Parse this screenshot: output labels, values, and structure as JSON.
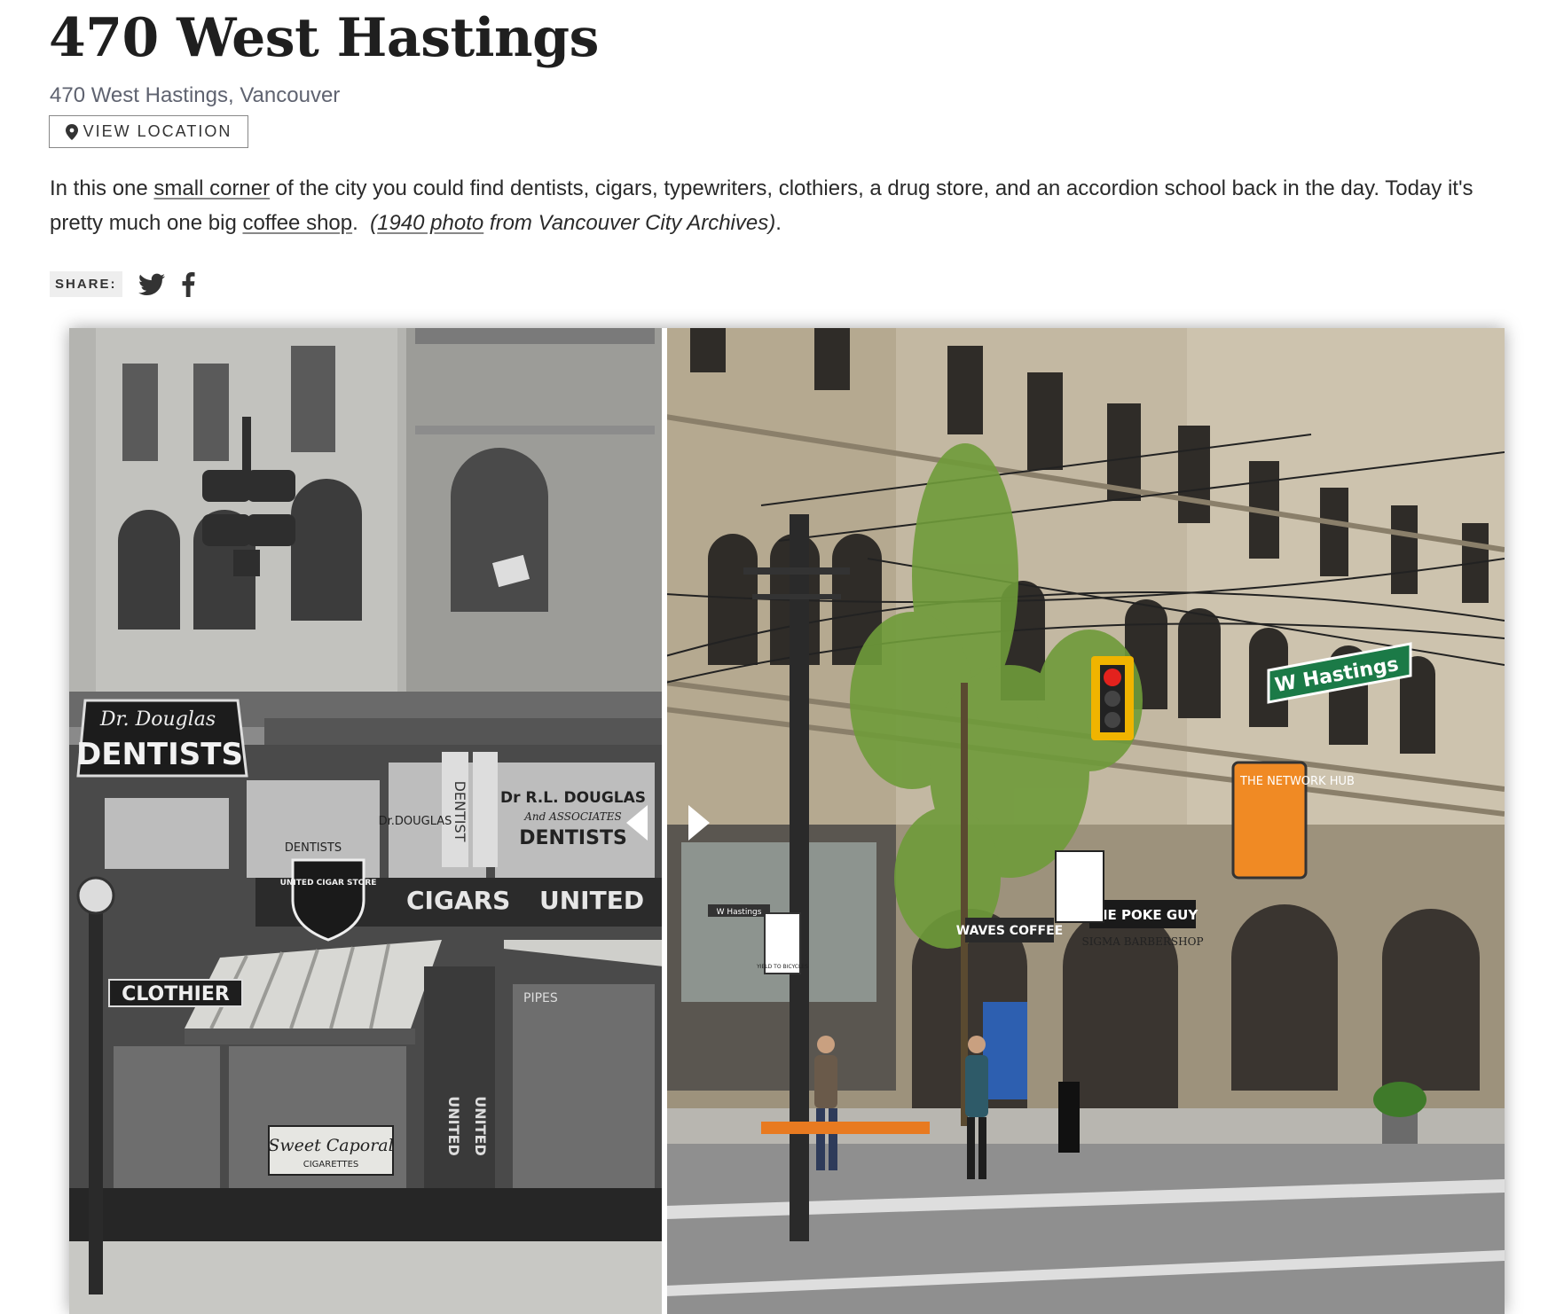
{
  "post": {
    "title": "470 West Hastings",
    "address": "470 West Hastings, Vancouver",
    "view_location_label": "VIEW LOCATION",
    "description": {
      "part1": "In this one ",
      "link1": "small corner",
      "part2": " of the city you could find dentists, cigars, typewriters, clothiers, a drug store, and an accordion school back in the day. Today it's pretty much one big ",
      "link2": "coffee shop",
      "part3": ".  ",
      "paren_open": "(",
      "link3": "1940 photo",
      "part4": " from Vancouver City Archives)",
      "part5": "."
    }
  },
  "share": {
    "label": "SHARE:",
    "icons": [
      "twitter-icon",
      "facebook-icon"
    ]
  },
  "comparison": {
    "then_signs": {
      "dentists_script": "Dr. Douglas",
      "dentists": "DENTISTS",
      "dentist_vertical": "DENTIST",
      "drl_douglas": "Dr R.L. DOUGLAS",
      "associates": "And ASSOCIATES",
      "dentists2": "DENTISTS",
      "dr_douglas_small": "Dr.DOUGLAS",
      "dentists_small": "DENTISTS",
      "united_cigar": "UNITED CIGAR STORE",
      "cigars": "CIGARS",
      "united": "UNITED",
      "clothier": "CLOTHIER",
      "sweet_caporal": "Sweet Caporal",
      "cigarettes": "CIGARETTES",
      "pipes": "PIPES"
    },
    "now_signs": {
      "street_sign": "W Hastings",
      "network_hub": "THE NETWORK HUB",
      "waves": "WAVES COFFEE",
      "poke_guy": "THE POKE GUY",
      "sigma": "SIGMA BARBERSHOP",
      "w_hastings_small": "W Hastings",
      "yield": "YIELD TO BICYCLES"
    }
  }
}
